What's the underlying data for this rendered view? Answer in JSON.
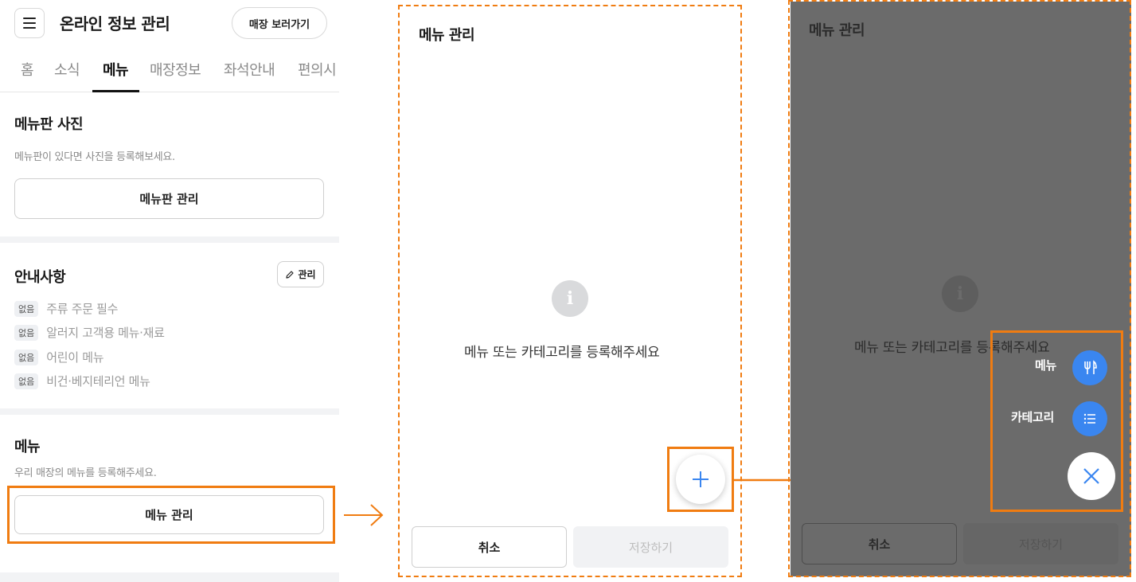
{
  "header": {
    "title": "온라인 정보 관리",
    "store_button": "매장 보러가기"
  },
  "tabs": [
    "홈",
    "소식",
    "메뉴",
    "매장정보",
    "좌석안내",
    "편의시"
  ],
  "active_tab": "메뉴",
  "menu_board": {
    "title": "메뉴판 사진",
    "description": "메뉴판이 있다면 사진을 등록해보세요.",
    "button": "메뉴판 관리"
  },
  "notices": {
    "title": "안내사항",
    "edit_button": "관리",
    "items": [
      {
        "badge": "없음",
        "text": "주류 주문 필수"
      },
      {
        "badge": "없음",
        "text": "알러지 고객용 메뉴·재료"
      },
      {
        "badge": "없음",
        "text": "어린이 메뉴"
      },
      {
        "badge": "없음",
        "text": "비건·베지테리언 메뉴"
      }
    ]
  },
  "menu_section": {
    "title": "메뉴",
    "description": "우리 매장의 메뉴를 등록해주세요.",
    "button": "메뉴 관리"
  },
  "menu_modal": {
    "title": "메뉴 관리",
    "empty_message": "메뉴 또는 카테고리를 등록해주세요",
    "cancel_button": "취소",
    "save_button": "저장하기"
  },
  "speed_dial": {
    "items": [
      {
        "label": "메뉴",
        "icon": "utensils-icon"
      },
      {
        "label": "카테고리",
        "icon": "list-icon"
      }
    ]
  },
  "colors": {
    "accent_orange": "#f07c11",
    "fab_blue": "#3a86f0",
    "dim_overlay": "#6b6b6b"
  }
}
